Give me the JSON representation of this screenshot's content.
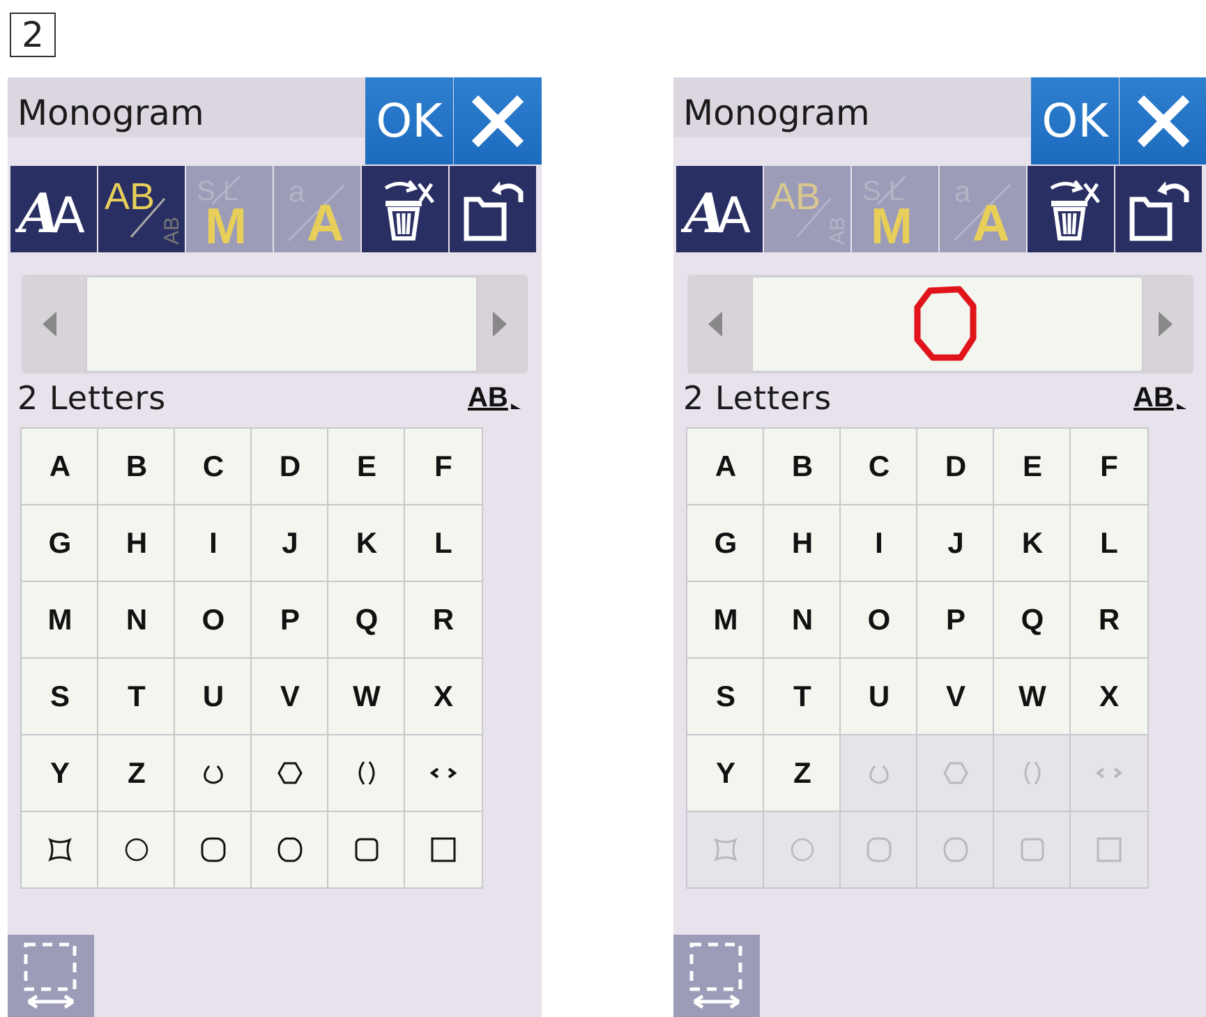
{
  "step_number": "2",
  "panels": [
    {
      "title": "Monogram",
      "ok_label": "OK",
      "status_text": "2 Letters",
      "ab_label": "AB",
      "preview_has_frame": false,
      "tools": [
        "aa-font-icon",
        "ab-layout-icon",
        "slm-size-icon",
        "case-icon",
        "delete-icon",
        "open-file-icon"
      ],
      "active_tools": [
        0,
        1
      ],
      "keys_letters": [
        "A",
        "B",
        "C",
        "D",
        "E",
        "F",
        "G",
        "H",
        "I",
        "J",
        "K",
        "L",
        "M",
        "N",
        "O",
        "P",
        "Q",
        "R",
        "S",
        "T",
        "U",
        "V",
        "W",
        "X",
        "Y",
        "Z"
      ],
      "disabled_frames": false
    },
    {
      "title": "Monogram",
      "ok_label": "OK",
      "status_text": "2 Letters",
      "ab_label": "AB",
      "preview_has_frame": true,
      "tools": [
        "aa-font-icon",
        "ab-layout-icon",
        "slm-size-icon",
        "case-icon",
        "delete-icon",
        "open-file-icon"
      ],
      "active_tools": [
        0
      ],
      "keys_letters": [
        "A",
        "B",
        "C",
        "D",
        "E",
        "F",
        "G",
        "H",
        "I",
        "J",
        "K",
        "L",
        "M",
        "N",
        "O",
        "P",
        "Q",
        "R",
        "S",
        "T",
        "U",
        "V",
        "W",
        "X",
        "Y",
        "Z"
      ],
      "disabled_frames": true
    }
  ],
  "colors": {
    "ok_blue": "#1c6bbf",
    "toolbar_dark": "#2a2f63",
    "toolbar_dim": "#9d9cb8",
    "accent_yellow": "#e7cf5a",
    "frame_red": "#e0141a"
  }
}
